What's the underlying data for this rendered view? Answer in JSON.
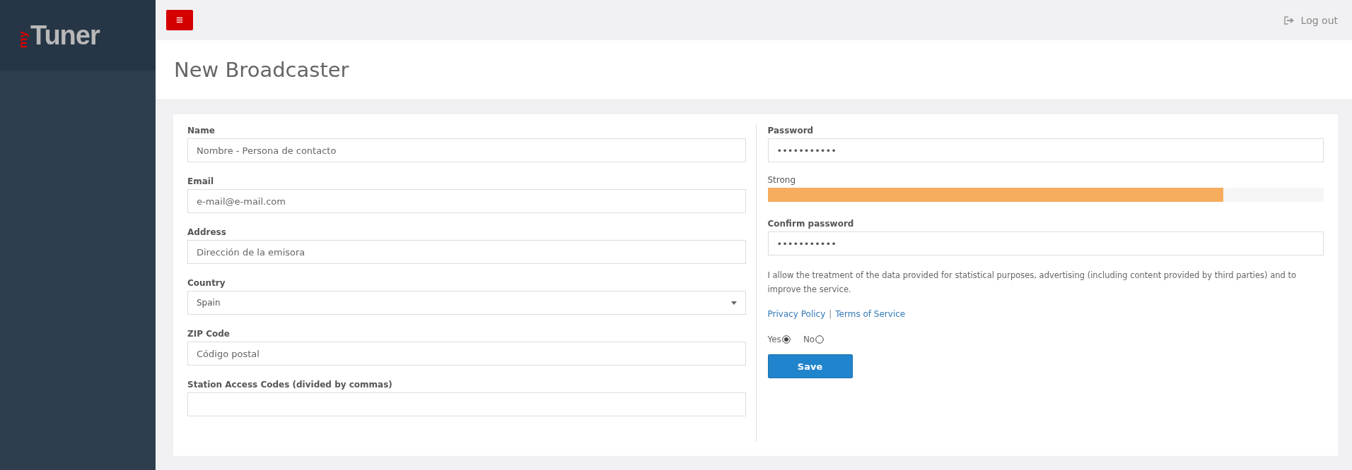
{
  "logo": {
    "prefix": "my",
    "name": "Tuner"
  },
  "topbar": {
    "menu_button": "≡",
    "logout": "Log out"
  },
  "page_title": "New Broadcaster",
  "left_fields": [
    {
      "label": "Name",
      "kind": "text",
      "placeholder": "Nombre - Persona de contacto"
    },
    {
      "label": "Email",
      "kind": "text",
      "placeholder": "e-mail@e-mail.com"
    },
    {
      "label": "Address",
      "kind": "text",
      "placeholder": "Dirección de la emisora"
    },
    {
      "label": "Country",
      "kind": "select",
      "value": "Spain"
    },
    {
      "label": "ZIP Code",
      "kind": "text",
      "placeholder": "Código postal"
    },
    {
      "label": "Station Access Codes (divided by commas)",
      "kind": "text"
    }
  ],
  "password": {
    "label": "Password",
    "value": "•••••••••••"
  },
  "strength": {
    "label": "Strong",
    "level": 0.82
  },
  "confirm_password": {
    "label": "Confirm password",
    "value": "•••••••••••"
  },
  "consent_text": "I allow the treatment of the data provided for statistical purposes, advertising (including content provided by third parties) and to improve the service.",
  "links": [
    "Privacy Policy",
    "Terms of Service"
  ],
  "link_separator": "|",
  "consent_options": [
    {
      "label": "Yes",
      "selected": true
    },
    {
      "label": "No",
      "selected": false
    }
  ],
  "save_button": "Save"
}
